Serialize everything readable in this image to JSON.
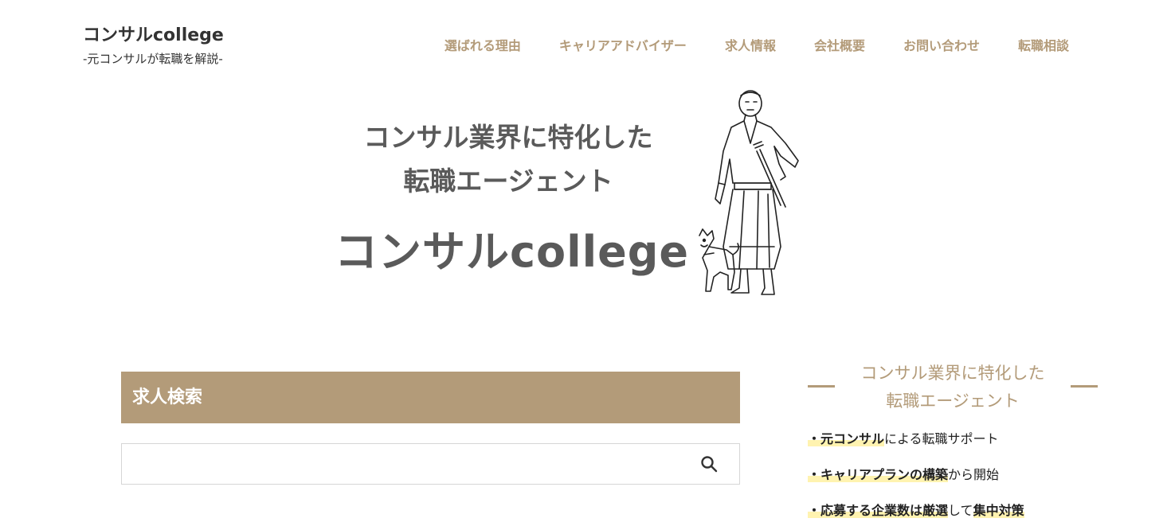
{
  "header": {
    "site_title": "コンサルcollege",
    "site_subtitle": "-元コンサルが転職を解説-"
  },
  "nav": {
    "items": [
      "選ばれる理由",
      "キャリアアドバイザー",
      "求人情報",
      "会社概要",
      "お問い合わせ",
      "転職相談"
    ]
  },
  "hero": {
    "line1": "コンサル業界に特化した",
    "line2": "転職エージェント",
    "brand": "コンサルcollege"
  },
  "search": {
    "heading": "求人検索",
    "placeholder": "",
    "icon": "search-icon"
  },
  "sidebar": {
    "title_line1": "コンサル業界に特化した",
    "title_line2": "転職エージェント",
    "features": [
      {
        "bullet": "・",
        "b1": "元コンサル",
        "t1": "による転職サポート",
        "b2": "",
        "t2": ""
      },
      {
        "bullet": "・",
        "b1": "キャリアプランの構築",
        "t1": "から開始",
        "b2": "",
        "t2": ""
      },
      {
        "bullet": "・",
        "b1": "応募する企業数は厳選",
        "t1": "して",
        "b2": "集中対策",
        "t2": ""
      }
    ]
  },
  "colors": {
    "accent": "#b39b79",
    "hero_text": "#5a5a5a",
    "highlight": "#fff3b0"
  }
}
